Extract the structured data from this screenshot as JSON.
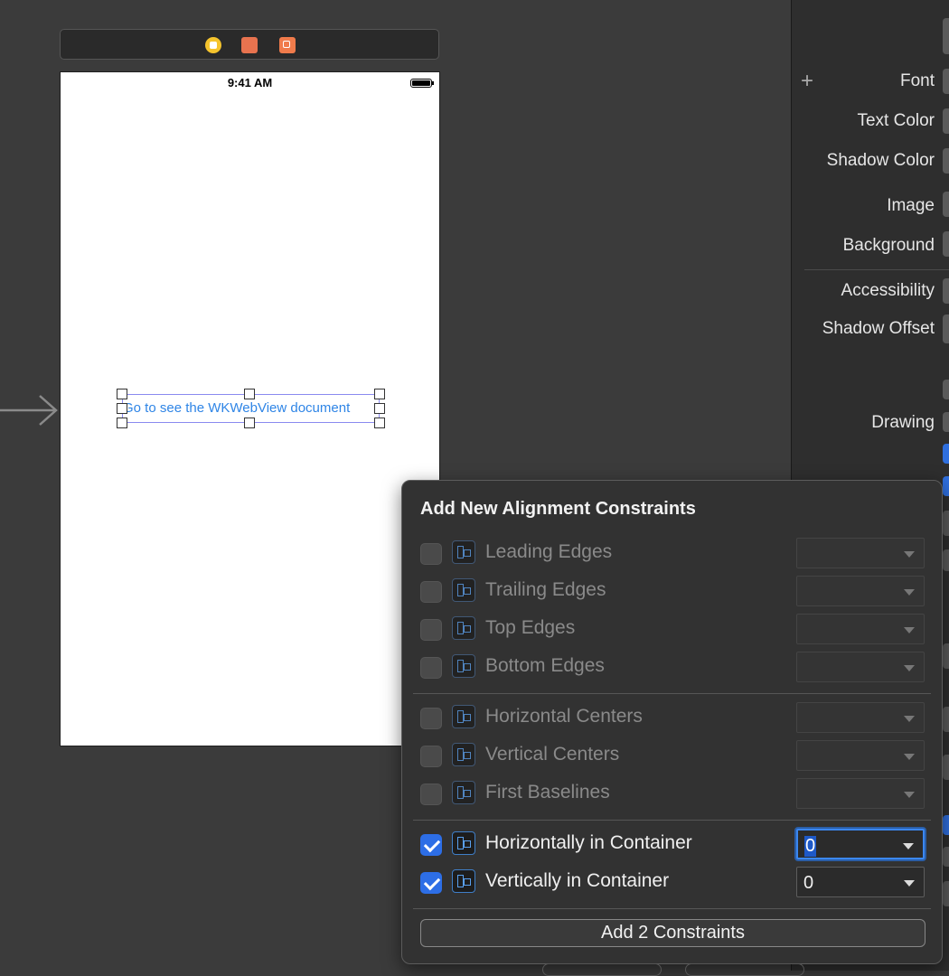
{
  "device": {
    "status_time": "9:41 AM",
    "button_title": "Go to see the WKWebView document"
  },
  "scene_dock": {
    "icons": [
      "view-controller-icon",
      "first-responder-icon",
      "exit-icon"
    ]
  },
  "inspector": {
    "labels": {
      "font": "Font",
      "text_color": "Text Color",
      "shadow_color": "Shadow Color",
      "image": "Image",
      "background": "Background",
      "accessibility": "Accessibility",
      "shadow_offset": "Shadow Offset",
      "drawing": "Drawing"
    }
  },
  "popover": {
    "title": "Add New Alignment Constraints",
    "rows": [
      {
        "label": "Leading Edges",
        "checked": false,
        "value": ""
      },
      {
        "label": "Trailing Edges",
        "checked": false,
        "value": ""
      },
      {
        "label": "Top Edges",
        "checked": false,
        "value": ""
      },
      {
        "label": "Bottom Edges",
        "checked": false,
        "value": ""
      },
      {
        "label": "Horizontal Centers",
        "checked": false,
        "value": ""
      },
      {
        "label": "Vertical Centers",
        "checked": false,
        "value": ""
      },
      {
        "label": "First Baselines",
        "checked": false,
        "value": ""
      },
      {
        "label": "Horizontally in Container",
        "checked": true,
        "value": "0"
      },
      {
        "label": "Vertically in Container",
        "checked": true,
        "value": "0"
      }
    ],
    "add_button": "Add 2 Constraints"
  },
  "colors": {
    "accent": "#2d6ee6",
    "canvas_bg": "#3b3b3b",
    "link_blue": "#2f85e6"
  }
}
